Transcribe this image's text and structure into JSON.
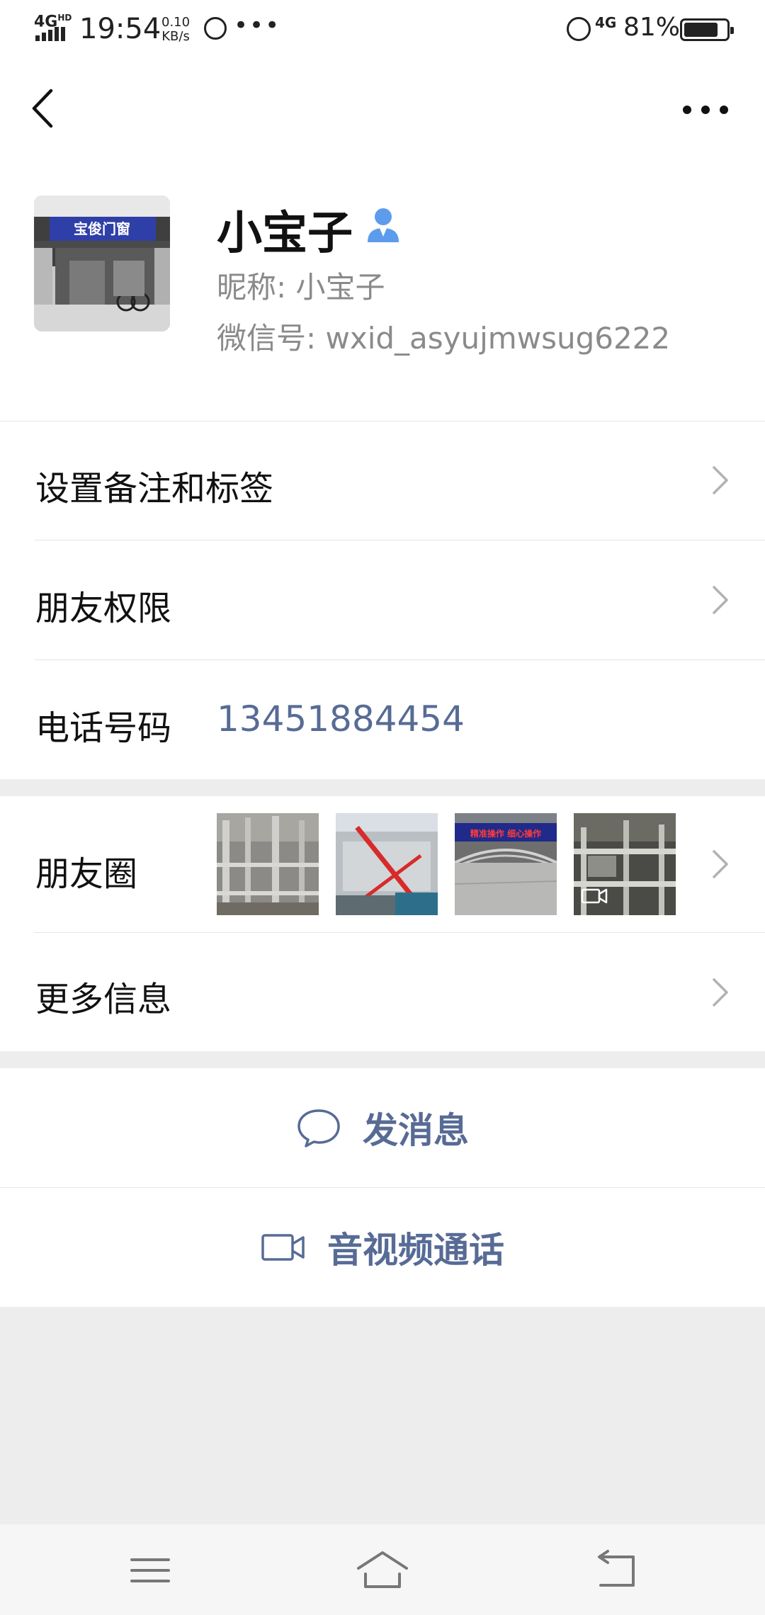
{
  "status_bar": {
    "network": "4G",
    "network_hd": "HD",
    "time": "19:54",
    "speed_value": "0.10",
    "speed_unit": "KB/s",
    "more": "•••",
    "network_right": "4G",
    "battery_percent": "81%",
    "battery_level": 0.81
  },
  "profile": {
    "name": "小宝子",
    "nickname": "昵称: 小宝子",
    "wechat_id": "微信号: wxid_asyujmwsug6222",
    "avatar_sign": "宝俊门窗",
    "accent_color": "#576b95"
  },
  "list": {
    "remark_tags": "设置备注和标签",
    "friend_permissions": "朋友权限",
    "phone_label": "电话号码",
    "phone_value": "13451884454",
    "moments_label": "朋友圈",
    "more_info": "更多信息"
  },
  "moments_thumbs": [
    {
      "icon": "photo-icon"
    },
    {
      "icon": "photo-icon"
    },
    {
      "icon": "photo-icon",
      "banner": "精准操作 细心操作"
    },
    {
      "icon": "video-icon"
    }
  ],
  "actions": {
    "message": "发消息",
    "call": "音视频通话"
  },
  "icons": {
    "back": "chevron-left-icon",
    "more": "more-dots-icon",
    "contact": "contact-person-icon",
    "message": "chat-bubble-icon",
    "call": "video-camera-icon",
    "arrow": "chevron-right-icon",
    "nav_menu": "menu-icon",
    "nav_home": "home-icon",
    "nav_back": "back-return-icon"
  }
}
